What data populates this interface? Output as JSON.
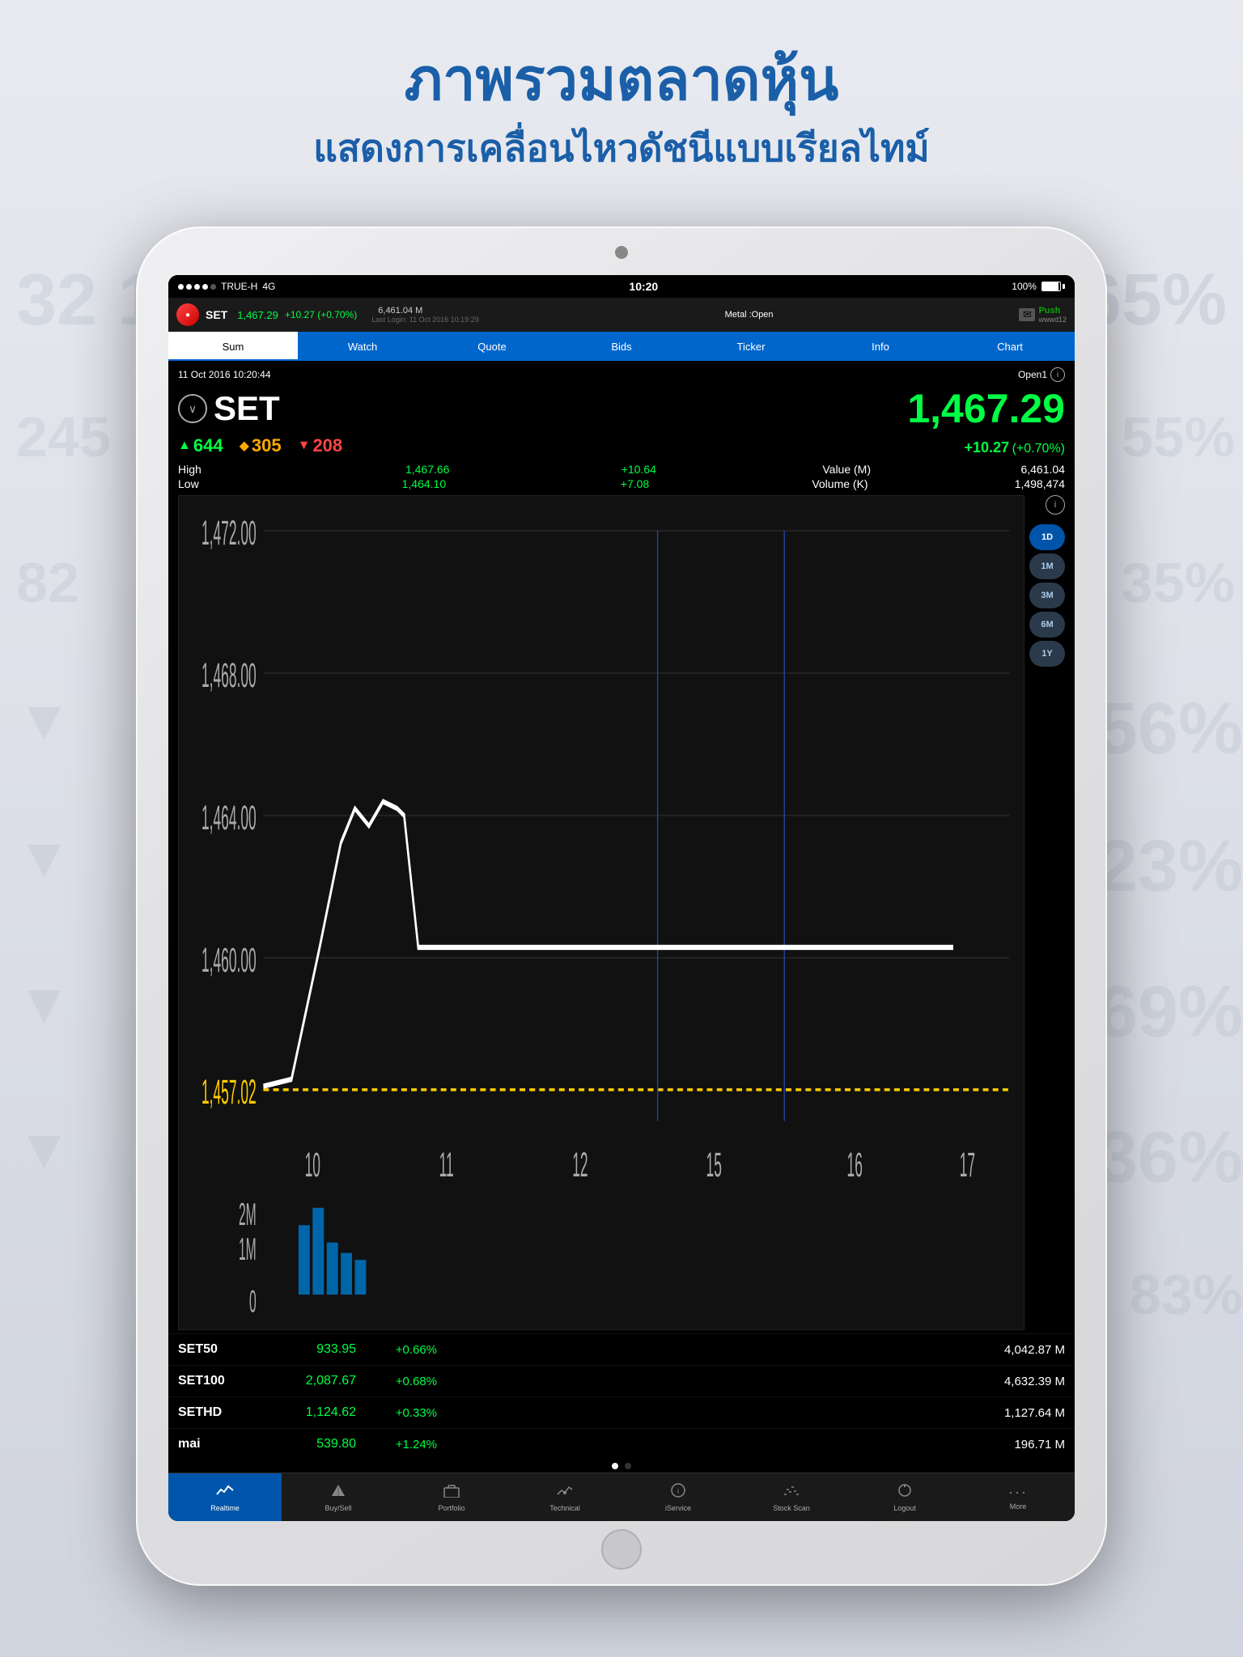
{
  "header": {
    "title": "ภาพรวมตลาดหุ้น",
    "subtitle": "แสดงการเคลื่อนไหวดัชนีแบบเรียลไทม์"
  },
  "status_bar": {
    "carrier": "TRUE-H",
    "network": "4G",
    "time": "10:20",
    "battery": "100%"
  },
  "top_bar": {
    "symbol": "SET",
    "price": "1,467.29",
    "change": "+10.27",
    "change_pct": "(+0.70%)",
    "volume": "6,461.04 M",
    "last_login": "Last Login: 11 Oct 2016 10:19:29",
    "market_status": "Metal :Open",
    "push_label": "Push",
    "push_user": "wwwd12"
  },
  "nav_tabs": [
    "Sum",
    "Watch",
    "Quote",
    "Bids",
    "Ticker",
    "Info",
    "Chart"
  ],
  "content": {
    "datetime": "11 Oct 2016 10:20:44",
    "open_label": "Open1",
    "symbol": "SET",
    "price": "1,467.29",
    "change": "+10.27",
    "change_pct": "(+0.70%)",
    "up_count": "644",
    "neutral_count": "305",
    "down_count": "208",
    "high_label": "High",
    "high_price": "1,467.66",
    "high_change": "+10.64",
    "value_label": "Value (M)",
    "value": "6,461.04",
    "low_label": "Low",
    "low_price": "1,464.10",
    "low_change": "+7.08",
    "volume_label": "Volume (K)",
    "volume": "1,498,474"
  },
  "chart": {
    "y_labels": [
      "1,472.00",
      "1,468.00",
      "1,464.00",
      "1,460.00",
      "1,457.02"
    ],
    "x_labels": [
      "10",
      "11",
      "12",
      "15",
      "16",
      "17"
    ],
    "vol_labels": [
      "2M",
      "1M",
      "0"
    ],
    "buttons": [
      "1D",
      "1M",
      "3M",
      "6M",
      "1Y"
    ],
    "active_button": "1D"
  },
  "indices": [
    {
      "name": "SET50",
      "price": "933.95",
      "change": "+0.66%",
      "volume": "4,042.87 M"
    },
    {
      "name": "SET100",
      "price": "2,087.67",
      "change": "+0.68%",
      "volume": "4,632.39 M"
    },
    {
      "name": "SETHD",
      "price": "1,124.62",
      "change": "+0.33%",
      "volume": "1,127.64 M"
    },
    {
      "name": "mai",
      "price": "539.80",
      "change": "+1.24%",
      "volume": "196.71 M"
    }
  ],
  "bottom_nav": [
    {
      "icon": "📈",
      "label": "Realtime",
      "active": true
    },
    {
      "icon": "💱",
      "label": "Buy/Sell",
      "active": false
    },
    {
      "icon": "📁",
      "label": "Portfolio",
      "active": false
    },
    {
      "icon": "📊",
      "label": "Technical",
      "active": false
    },
    {
      "icon": "ℹ️",
      "label": "iService",
      "active": false
    },
    {
      "icon": "📉",
      "label": "Stock Scan",
      "active": false
    },
    {
      "icon": "⏻",
      "label": "Logout",
      "active": false
    },
    {
      "icon": "···",
      "label": "More",
      "active": false
    }
  ]
}
